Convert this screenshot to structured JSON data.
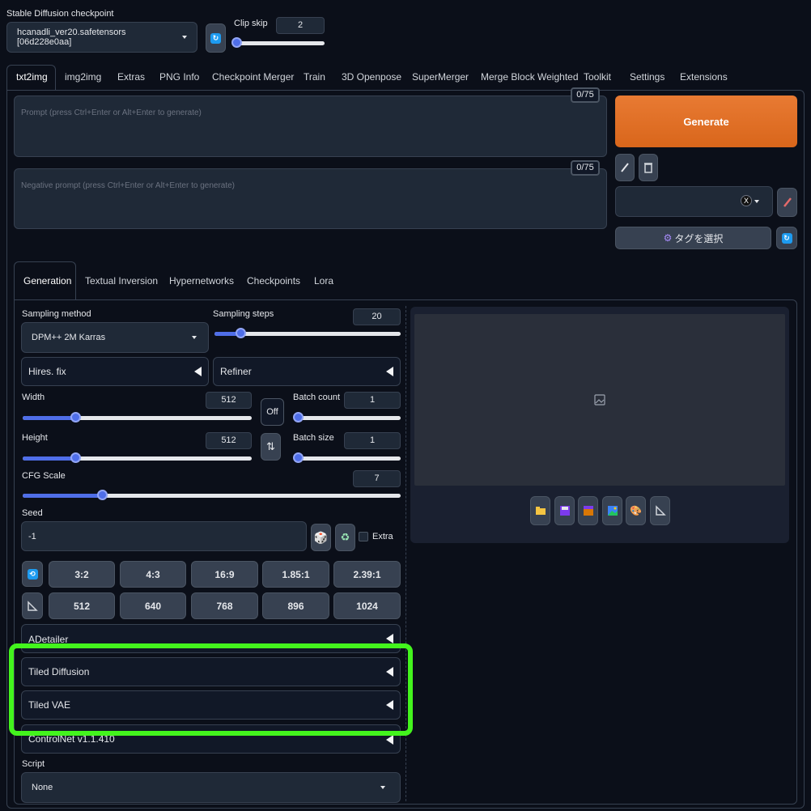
{
  "checkpoint": {
    "label": "Stable Diffusion checkpoint",
    "value": "hcanadli_ver20.safetensors [06d228e0aa]",
    "refresh_icon": "refresh-icon"
  },
  "clip_skip": {
    "label": "Clip skip",
    "value": "2",
    "level": 0.0
  },
  "tabs": [
    "txt2img",
    "img2img",
    "Extras",
    "PNG Info",
    "Checkpoint Merger",
    "Train",
    "3D Openpose",
    "SuperMerger",
    "Merge Block Weighted",
    "Toolkit",
    "Settings",
    "Extensions"
  ],
  "prompt": {
    "placeholder": "Prompt (press Ctrl+Enter or Alt+Enter to generate)",
    "token_count": "0/75"
  },
  "negative_prompt": {
    "placeholder": "Negative prompt (press Ctrl+Enter or Alt+Enter to generate)",
    "token_count": "0/75"
  },
  "generate_label": "Generate",
  "tag_select_label": "タグを選択",
  "style_clear": "X",
  "subtabs": [
    "Generation",
    "Textual Inversion",
    "Hypernetworks",
    "Checkpoints",
    "Lora"
  ],
  "sampling_method": {
    "label": "Sampling method",
    "value": "DPM++ 2M Karras"
  },
  "sampling_steps": {
    "label": "Sampling steps",
    "value": "20",
    "level": 0.15
  },
  "hires_label": "Hires. fix",
  "refiner_label": "Refiner",
  "width": {
    "label": "Width",
    "value": "512",
    "level": 0.24
  },
  "height": {
    "label": "Height",
    "value": "512",
    "level": 0.24
  },
  "off_label": "Off",
  "swap_icon": "⇅",
  "batch_count": {
    "label": "Batch count",
    "value": "1",
    "level": 0.0
  },
  "batch_size": {
    "label": "Batch size",
    "value": "1",
    "level": 0.0
  },
  "cfg_scale": {
    "label": "CFG Scale",
    "value": "7",
    "level": 0.21
  },
  "seed": {
    "label": "Seed",
    "value": "-1",
    "extra_label": "Extra"
  },
  "aspect_ratios": [
    "3:2",
    "4:3",
    "16:9",
    "1.85:1",
    "2.39:1"
  ],
  "sizes": [
    "512",
    "640",
    "768",
    "896",
    "1024"
  ],
  "accordions": [
    "ADetailer",
    "Tiled Diffusion",
    "Tiled VAE",
    "ControlNet v1.1.410"
  ],
  "script": {
    "label": "Script",
    "value": "None"
  },
  "highlight_color": "#43f41d",
  "accent_color": "#e07020"
}
